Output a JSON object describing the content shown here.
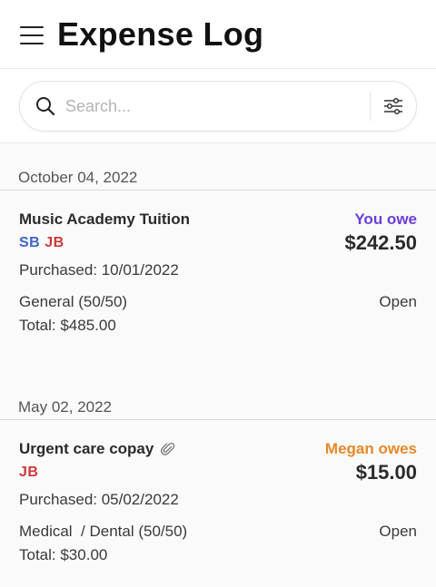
{
  "header": {
    "title": "Expense Log"
  },
  "search": {
    "placeholder": "Search..."
  },
  "colors": {
    "you_owe": "#6a3ed6",
    "other_owes": "#e7892a",
    "initials_sb": "#3d64c9",
    "initials_jb": "#cc3a3a"
  },
  "groups": [
    {
      "date": "October 04, 2022",
      "expense": {
        "title": "Music Academy Tuition",
        "has_attachment": false,
        "initials": [
          "SB",
          "JB"
        ],
        "owe_label": "You owe",
        "amount": "$242.50",
        "purchased": "Purchased: 10/01/2022",
        "category": "General (50/50)",
        "status": "Open",
        "total": "Total: $485.00"
      }
    },
    {
      "date": "May 02, 2022",
      "expense": {
        "title": "Urgent care copay",
        "has_attachment": true,
        "initials": [
          "JB"
        ],
        "owe_label": "Megan owes",
        "amount": "$15.00",
        "purchased": "Purchased: 05/02/2022",
        "category": "Medical  / Dental (50/50)",
        "status": "Open",
        "total": "Total: $30.00"
      }
    }
  ]
}
